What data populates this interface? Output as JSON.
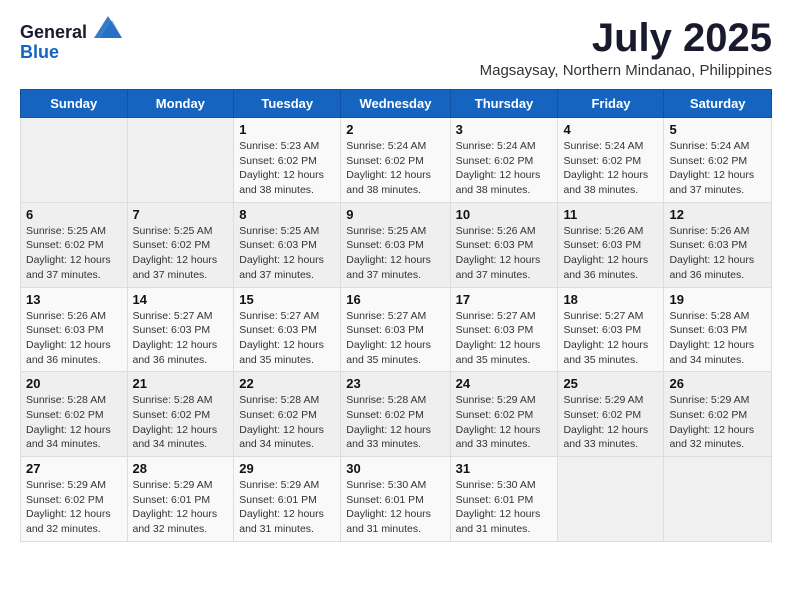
{
  "header": {
    "logo_general": "General",
    "logo_blue": "Blue",
    "month_title": "July 2025",
    "subtitle": "Magsaysay, Northern Mindanao, Philippines"
  },
  "weekdays": [
    "Sunday",
    "Monday",
    "Tuesday",
    "Wednesday",
    "Thursday",
    "Friday",
    "Saturday"
  ],
  "weeks": [
    [
      {
        "day": "",
        "sunrise": "",
        "sunset": "",
        "daylight": ""
      },
      {
        "day": "",
        "sunrise": "",
        "sunset": "",
        "daylight": ""
      },
      {
        "day": "1",
        "sunrise": "Sunrise: 5:23 AM",
        "sunset": "Sunset: 6:02 PM",
        "daylight": "Daylight: 12 hours and 38 minutes."
      },
      {
        "day": "2",
        "sunrise": "Sunrise: 5:24 AM",
        "sunset": "Sunset: 6:02 PM",
        "daylight": "Daylight: 12 hours and 38 minutes."
      },
      {
        "day": "3",
        "sunrise": "Sunrise: 5:24 AM",
        "sunset": "Sunset: 6:02 PM",
        "daylight": "Daylight: 12 hours and 38 minutes."
      },
      {
        "day": "4",
        "sunrise": "Sunrise: 5:24 AM",
        "sunset": "Sunset: 6:02 PM",
        "daylight": "Daylight: 12 hours and 38 minutes."
      },
      {
        "day": "5",
        "sunrise": "Sunrise: 5:24 AM",
        "sunset": "Sunset: 6:02 PM",
        "daylight": "Daylight: 12 hours and 37 minutes."
      }
    ],
    [
      {
        "day": "6",
        "sunrise": "Sunrise: 5:25 AM",
        "sunset": "Sunset: 6:02 PM",
        "daylight": "Daylight: 12 hours and 37 minutes."
      },
      {
        "day": "7",
        "sunrise": "Sunrise: 5:25 AM",
        "sunset": "Sunset: 6:02 PM",
        "daylight": "Daylight: 12 hours and 37 minutes."
      },
      {
        "day": "8",
        "sunrise": "Sunrise: 5:25 AM",
        "sunset": "Sunset: 6:03 PM",
        "daylight": "Daylight: 12 hours and 37 minutes."
      },
      {
        "day": "9",
        "sunrise": "Sunrise: 5:25 AM",
        "sunset": "Sunset: 6:03 PM",
        "daylight": "Daylight: 12 hours and 37 minutes."
      },
      {
        "day": "10",
        "sunrise": "Sunrise: 5:26 AM",
        "sunset": "Sunset: 6:03 PM",
        "daylight": "Daylight: 12 hours and 37 minutes."
      },
      {
        "day": "11",
        "sunrise": "Sunrise: 5:26 AM",
        "sunset": "Sunset: 6:03 PM",
        "daylight": "Daylight: 12 hours and 36 minutes."
      },
      {
        "day": "12",
        "sunrise": "Sunrise: 5:26 AM",
        "sunset": "Sunset: 6:03 PM",
        "daylight": "Daylight: 12 hours and 36 minutes."
      }
    ],
    [
      {
        "day": "13",
        "sunrise": "Sunrise: 5:26 AM",
        "sunset": "Sunset: 6:03 PM",
        "daylight": "Daylight: 12 hours and 36 minutes."
      },
      {
        "day": "14",
        "sunrise": "Sunrise: 5:27 AM",
        "sunset": "Sunset: 6:03 PM",
        "daylight": "Daylight: 12 hours and 36 minutes."
      },
      {
        "day": "15",
        "sunrise": "Sunrise: 5:27 AM",
        "sunset": "Sunset: 6:03 PM",
        "daylight": "Daylight: 12 hours and 35 minutes."
      },
      {
        "day": "16",
        "sunrise": "Sunrise: 5:27 AM",
        "sunset": "Sunset: 6:03 PM",
        "daylight": "Daylight: 12 hours and 35 minutes."
      },
      {
        "day": "17",
        "sunrise": "Sunrise: 5:27 AM",
        "sunset": "Sunset: 6:03 PM",
        "daylight": "Daylight: 12 hours and 35 minutes."
      },
      {
        "day": "18",
        "sunrise": "Sunrise: 5:27 AM",
        "sunset": "Sunset: 6:03 PM",
        "daylight": "Daylight: 12 hours and 35 minutes."
      },
      {
        "day": "19",
        "sunrise": "Sunrise: 5:28 AM",
        "sunset": "Sunset: 6:03 PM",
        "daylight": "Daylight: 12 hours and 34 minutes."
      }
    ],
    [
      {
        "day": "20",
        "sunrise": "Sunrise: 5:28 AM",
        "sunset": "Sunset: 6:02 PM",
        "daylight": "Daylight: 12 hours and 34 minutes."
      },
      {
        "day": "21",
        "sunrise": "Sunrise: 5:28 AM",
        "sunset": "Sunset: 6:02 PM",
        "daylight": "Daylight: 12 hours and 34 minutes."
      },
      {
        "day": "22",
        "sunrise": "Sunrise: 5:28 AM",
        "sunset": "Sunset: 6:02 PM",
        "daylight": "Daylight: 12 hours and 34 minutes."
      },
      {
        "day": "23",
        "sunrise": "Sunrise: 5:28 AM",
        "sunset": "Sunset: 6:02 PM",
        "daylight": "Daylight: 12 hours and 33 minutes."
      },
      {
        "day": "24",
        "sunrise": "Sunrise: 5:29 AM",
        "sunset": "Sunset: 6:02 PM",
        "daylight": "Daylight: 12 hours and 33 minutes."
      },
      {
        "day": "25",
        "sunrise": "Sunrise: 5:29 AM",
        "sunset": "Sunset: 6:02 PM",
        "daylight": "Daylight: 12 hours and 33 minutes."
      },
      {
        "day": "26",
        "sunrise": "Sunrise: 5:29 AM",
        "sunset": "Sunset: 6:02 PM",
        "daylight": "Daylight: 12 hours and 32 minutes."
      }
    ],
    [
      {
        "day": "27",
        "sunrise": "Sunrise: 5:29 AM",
        "sunset": "Sunset: 6:02 PM",
        "daylight": "Daylight: 12 hours and 32 minutes."
      },
      {
        "day": "28",
        "sunrise": "Sunrise: 5:29 AM",
        "sunset": "Sunset: 6:01 PM",
        "daylight": "Daylight: 12 hours and 32 minutes."
      },
      {
        "day": "29",
        "sunrise": "Sunrise: 5:29 AM",
        "sunset": "Sunset: 6:01 PM",
        "daylight": "Daylight: 12 hours and 31 minutes."
      },
      {
        "day": "30",
        "sunrise": "Sunrise: 5:30 AM",
        "sunset": "Sunset: 6:01 PM",
        "daylight": "Daylight: 12 hours and 31 minutes."
      },
      {
        "day": "31",
        "sunrise": "Sunrise: 5:30 AM",
        "sunset": "Sunset: 6:01 PM",
        "daylight": "Daylight: 12 hours and 31 minutes."
      },
      {
        "day": "",
        "sunrise": "",
        "sunset": "",
        "daylight": ""
      },
      {
        "day": "",
        "sunrise": "",
        "sunset": "",
        "daylight": ""
      }
    ]
  ]
}
